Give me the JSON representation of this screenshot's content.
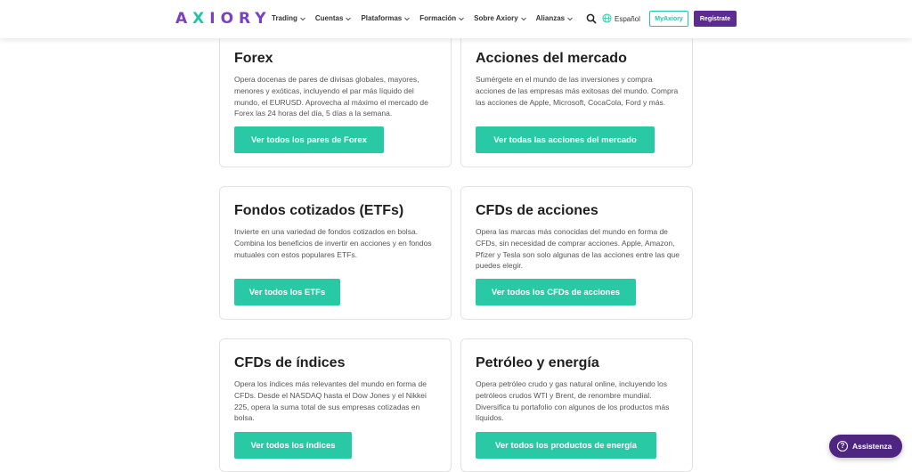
{
  "header": {
    "logo": "AXIORY",
    "nav": [
      "Trading",
      "Cuentas",
      "Plataformas",
      "Formación",
      "Sobre Axiory",
      "Alianzas"
    ],
    "language": "Español",
    "myaxiory": "MyAxiory",
    "register": "Regístrate"
  },
  "cards": [
    {
      "title": "Forex",
      "text": "Opera docenas de pares de divisas globales, mayores, menores y exóticas, incluyendo el par más líquido del mundo, el EURUSD. Aprovecha al máximo el mercado de Forex las 24 horas del día, 5 días a la semana.",
      "button": "Ver todos los pares de Forex"
    },
    {
      "title": "Acciones del mercado",
      "text": "Sumérgete en el mundo de las inversiones y compra acciones de las empresas más exitosas del mundo. Compra las acciones de Apple, Microsoft, CocaCola, Ford y más.",
      "button": "Ver todas las acciones del mercado"
    },
    {
      "title": "Fondos cotizados (ETFs)",
      "text": "Invierte en una variedad de fondos cotizados en bolsa. Combina los beneficios de invertir en acciones y en fondos mutuales con estos populares ETFs.",
      "button": "Ver todos los ETFs"
    },
    {
      "title": "CFDs de acciones",
      "text": "Opera las marcas más conocidas del mundo en forma de CFDs, sin necesidad de comprar acciones. Apple, Amazon, Pfizer y Tesla son solo algunas de las acciones entre las que puedes elegir.",
      "button": "Ver todos los CFDs de acciones"
    },
    {
      "title": "CFDs de índices",
      "text": "Opera los índices más relevantes del mundo en forma de CFDs. Desde el NASDAQ hasta el Dow Jones y el Nikkei 225, opera la suma total de sus empresas cotizadas en bolsa.",
      "button": "Ver todos los índices"
    },
    {
      "title": "Petróleo y energía",
      "text": "Opera petróleo crudo y gas natural online, incluyendo los petróleos crudos WTI y Brent, de renombre mundial. Diversifica tu portafolio con algunos de los productos más líquidos.",
      "button": "Ver todos los productos de energía"
    }
  ],
  "assist": "Assistenza",
  "colors": {
    "brand_purple": "#5c2d91",
    "accent_teal": "#2ac9a6",
    "assist_bg": "#4e2580"
  }
}
